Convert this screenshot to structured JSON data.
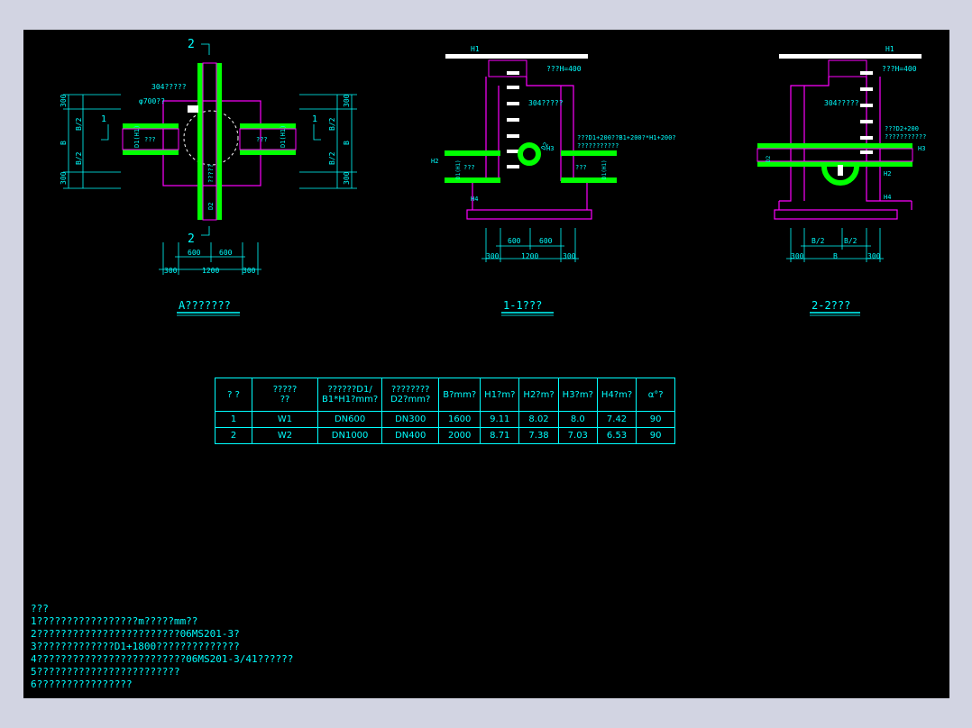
{
  "views": {
    "plan": {
      "title": "A???????",
      "label_2_top": "2",
      "label_2_bot": "2",
      "label_1_left": "1",
      "label_1_right": "1",
      "dim_300_top": "300",
      "dim_b2_top": "B/2",
      "dim_b": "B",
      "dim_b2_bot": "B/2",
      "dim_300_bot": "300",
      "dim_600_l": "600",
      "dim_600_r": "600",
      "dim_1200": "1200",
      "dim_300_l": "300",
      "dim_300_r": "300",
      "note_ladder": "304?????",
      "note_phi": "φ700??",
      "pipe_d1": "D1(H1)",
      "pipe_d2": "D2",
      "flow_l": "???",
      "flow_r": "???",
      "flow_v": "?????"
    },
    "s11": {
      "title": "1-1???",
      "h1": "H1",
      "note_h400": "???H=400",
      "note_ladder": "304?????",
      "note_d1": "???D1+200??B1+200?*H1+200?",
      "note_d1b": "???????????",
      "d2": "D2",
      "h2": "H2",
      "h3": "H3",
      "h4": "H4",
      "pipe_l": "D1(H1)",
      "pipe_r": "D1(H1)",
      "flow_l": "???",
      "flow_r": "???",
      "dim_600_l": "600",
      "dim_600_r": "600",
      "dim_1200": "1200",
      "dim_300_l": "300",
      "dim_300_r": "300"
    },
    "s22": {
      "title": "2-2???",
      "h1": "H1",
      "note_h400": "???H=400",
      "note_ladder": "304?????",
      "note_d2": "???D2+200",
      "note_d2b": "???????????",
      "h2": "H2",
      "h3": "H3",
      "h4": "H4",
      "pipe": "D2",
      "dim_b2_l": "B/2",
      "dim_b2_r": "B/2",
      "dim_b": "B",
      "dim_300_l": "300",
      "dim_300_r": "300"
    }
  },
  "table": {
    "headers": [
      "? ?",
      "?????\n??",
      "??????D1/\nB1*H1?mm?",
      "????????\nD2?mm?",
      "B?mm?",
      "H1?m?",
      "H2?m?",
      "H3?m?",
      "H4?m?",
      "α°?"
    ],
    "rows": [
      [
        "1",
        "W1",
        "DN600",
        "DN300",
        "1600",
        "9.11",
        "8.02",
        "8.0",
        "7.42",
        "90"
      ],
      [
        "2",
        "W2",
        "DN1000",
        "DN400",
        "2000",
        "8.71",
        "7.38",
        "7.03",
        "6.53",
        "90"
      ]
    ]
  },
  "notes": [
    "???",
    "1?????????????????m?????mm??",
    "2????????????????????????06MS201-3?",
    "3?????????????D1+1800??????????????",
    "4?????????????????????????06MS201-3/41??????",
    "5????????????????????????",
    "6????????????????"
  ]
}
